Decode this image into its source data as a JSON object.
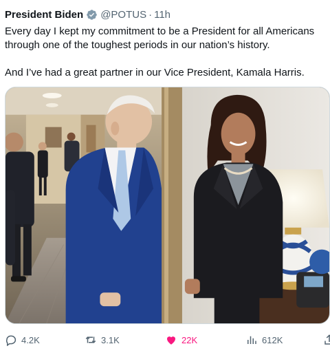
{
  "tweet": {
    "author_name": "President Biden",
    "handle": "@POTUS",
    "separator": "·",
    "time": "11h",
    "paragraphs": [
      "Every day I kept my commitment to be a President for all Americans through one of the toughest periods in our nation’s history.",
      "And I’ve had a great partner in our Vice President, Kamala Harris."
    ],
    "verified_badge_color": "#829aab",
    "like_color": "#f91880"
  },
  "actions": {
    "replies": "4.2K",
    "retweets": "3.1K",
    "likes": "22K",
    "views": "612K"
  },
  "icons": {
    "verified": "verified-badge-icon",
    "reply": "reply-icon",
    "retweet": "retweet-icon",
    "like": "heart-icon",
    "views": "views-icon",
    "share": "share-icon"
  }
}
